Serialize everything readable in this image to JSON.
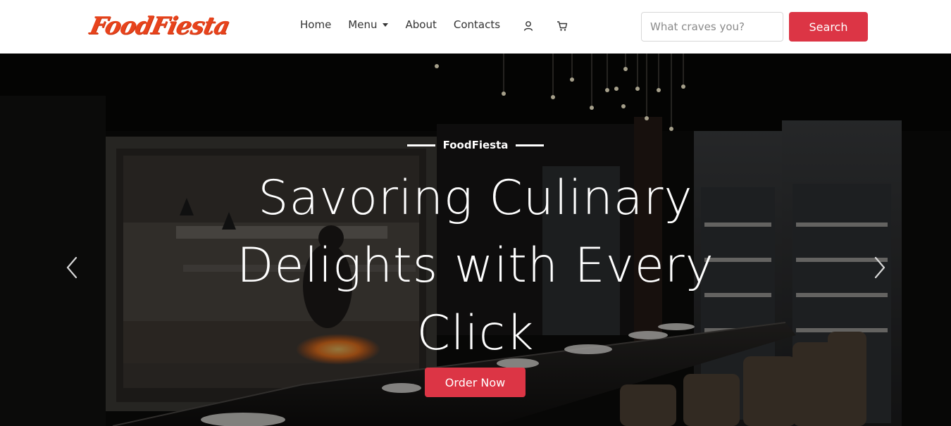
{
  "brand": {
    "logo_text": "FoodFiesta",
    "accent": "#e8431c"
  },
  "nav": {
    "items": [
      {
        "label": "Home"
      },
      {
        "label": "Menu",
        "has_dropdown": true
      },
      {
        "label": "About"
      },
      {
        "label": "Contacts"
      }
    ],
    "icons": [
      "user-icon",
      "cart-icon"
    ]
  },
  "search": {
    "placeholder": "What craves you?",
    "value": "",
    "button_label": "Search",
    "button_color": "#dc3545"
  },
  "hero": {
    "eyebrow": "FoodFiesta",
    "headline": "Savoring Culinary Delights with Every Click",
    "cta_label": "Order Now",
    "controls": [
      "chevron-left-icon",
      "chevron-right-icon"
    ]
  }
}
